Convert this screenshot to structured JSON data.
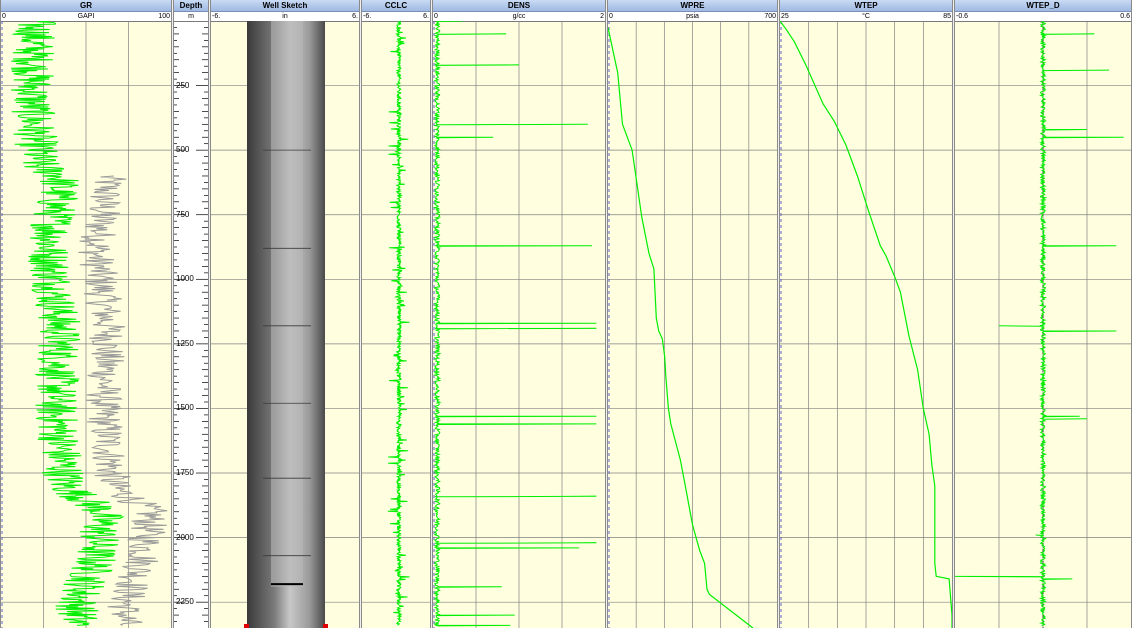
{
  "depth_axis": {
    "title": "Depth",
    "unit": "m",
    "range": [
      0,
      2350
    ],
    "labels": [
      "250",
      "500",
      "750",
      "1000",
      "1250",
      "1500",
      "1750",
      "2000",
      "2250"
    ]
  },
  "tracks": {
    "gr": {
      "title": "GR",
      "min": "0",
      "unit": "GAPI",
      "max": "100"
    },
    "depth": {
      "title": "Depth",
      "unit": "m"
    },
    "sketch": {
      "title": "Well Sketch",
      "min": "-6.",
      "unit": "in",
      "max": "6."
    },
    "cclc": {
      "title": "CCLC",
      "min": "-6.",
      "max": "6."
    },
    "dens": {
      "title": "DENS",
      "min": "0",
      "unit": "g/cc",
      "max": "2"
    },
    "wpre": {
      "title": "WPRE",
      "min": "0",
      "unit": "psia",
      "max": "700"
    },
    "wtep": {
      "title": "WTEP",
      "min": "25",
      "unit": "°C",
      "max": "85"
    },
    "wtepd": {
      "title": "WTEP_D",
      "min": "-0.6",
      "max": "0.6"
    }
  },
  "colors": {
    "curve": "#00ee00",
    "gr_secondary": "#999999",
    "track_bg": "#ffffdf",
    "grid": "#808080",
    "header": "#b8cdef"
  },
  "chart_data": {
    "type": "line",
    "depth_unit": "m",
    "y_range": [
      0,
      2350
    ],
    "series": [
      {
        "name": "WPRE",
        "unit": "psia",
        "x_range": [
          0,
          700
        ],
        "points": [
          [
            0,
            25
          ],
          [
            40,
            200
          ],
          [
            60,
            400
          ],
          [
            100,
            500
          ],
          [
            140,
            760
          ],
          [
            170,
            900
          ],
          [
            190,
            960
          ],
          [
            200,
            1150
          ],
          [
            210,
            1200
          ],
          [
            225,
            1230
          ],
          [
            235,
            1300
          ],
          [
            240,
            1380
          ],
          [
            250,
            1500
          ],
          [
            260,
            1560
          ],
          [
            300,
            1700
          ],
          [
            320,
            1800
          ],
          [
            350,
            1950
          ],
          [
            380,
            2050
          ],
          [
            400,
            2100
          ],
          [
            410,
            2200
          ],
          [
            420,
            2220
          ],
          [
            600,
            2350
          ]
        ]
      },
      {
        "name": "WTEP",
        "unit": "°C",
        "x_range": [
          25,
          85
        ],
        "points": [
          [
            25,
            0
          ],
          [
            27,
            30
          ],
          [
            30,
            80
          ],
          [
            34,
            170
          ],
          [
            40,
            320
          ],
          [
            44,
            390
          ],
          [
            48,
            480
          ],
          [
            52,
            600
          ],
          [
            56,
            740
          ],
          [
            60,
            870
          ],
          [
            62,
            910
          ],
          [
            65,
            990
          ],
          [
            67,
            1050
          ],
          [
            70,
            1220
          ],
          [
            73,
            1350
          ],
          [
            75,
            1500
          ],
          [
            77,
            1600
          ],
          [
            78,
            1720
          ],
          [
            79,
            1800
          ],
          [
            79,
            2100
          ],
          [
            79.5,
            2150
          ],
          [
            84,
            2160
          ],
          [
            85,
            2300
          ],
          [
            85,
            2350
          ]
        ]
      },
      {
        "name": "DENS",
        "unit": "g/cc",
        "x_range": [
          0,
          2
        ],
        "baseline": 0.05,
        "spikes": [
          [
            0,
            0.35
          ],
          [
            50,
            0.85
          ],
          [
            170,
            1.0
          ],
          [
            400,
            1.8
          ],
          [
            450,
            0.7
          ],
          [
            870,
            1.85
          ],
          [
            1170,
            1.9
          ],
          [
            1190,
            1.9
          ],
          [
            1530,
            1.9
          ],
          [
            1560,
            1.9
          ],
          [
            1840,
            1.9
          ],
          [
            2020,
            1.9
          ],
          [
            2040,
            1.7
          ],
          [
            2190,
            0.8
          ],
          [
            2300,
            0.95
          ],
          [
            2340,
            0.9
          ]
        ]
      },
      {
        "name": "WTEP_D",
        "unit": "",
        "x_range": [
          -0.6,
          0.6
        ],
        "baseline": 0.0,
        "spikes": [
          [
            50,
            0.35
          ],
          [
            190,
            0.45
          ],
          [
            420,
            0.3
          ],
          [
            450,
            0.55
          ],
          [
            870,
            0.5
          ],
          [
            1180,
            -0.3
          ],
          [
            1200,
            0.5
          ],
          [
            1530,
            0.25
          ],
          [
            1540,
            0.3
          ],
          [
            1990,
            -0.05
          ],
          [
            2150,
            -0.65
          ],
          [
            2160,
            0.2
          ]
        ]
      },
      {
        "name": "GR",
        "unit": "GAPI",
        "x_range": [
          0,
          100
        ],
        "profile": [
          [
            0,
            20
          ],
          [
            300,
            18
          ],
          [
            560,
            22
          ],
          [
            600,
            35
          ],
          [
            900,
            28
          ],
          [
            1200,
            35
          ],
          [
            1500,
            32
          ],
          [
            1800,
            38
          ],
          [
            1900,
            60
          ],
          [
            2100,
            55
          ],
          [
            2250,
            45
          ],
          [
            2350,
            45
          ]
        ]
      },
      {
        "name": "CCLC",
        "unit": "",
        "x_range": [
          -6,
          6
        ],
        "baseline": 0.5
      }
    ]
  }
}
